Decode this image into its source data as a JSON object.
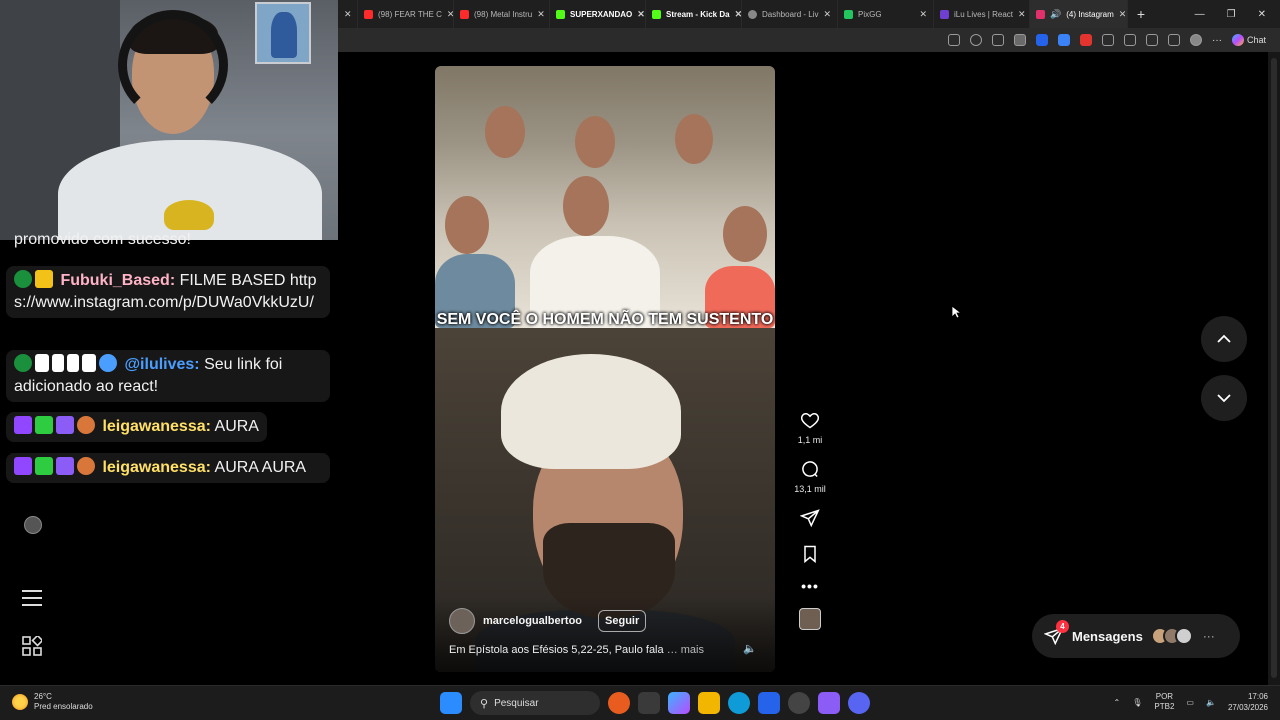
{
  "browser": {
    "tabs": [
      {
        "label": "",
        "icon_color": "#ffffff"
      },
      {
        "label": "(98) FEAR THE C",
        "icon_color": "#ff2a2a"
      },
      {
        "label": "(98) Metal Instru",
        "icon_color": "#ff2a2a"
      },
      {
        "label": "SUPERXANDAO",
        "icon_color": "#53fc18"
      },
      {
        "label": "Stream - Kick Da",
        "icon_color": "#53fc18"
      },
      {
        "label": "Dashboard - Liv",
        "icon_color": "#888888"
      },
      {
        "label": "PixGG",
        "icon_color": "#22c55e"
      },
      {
        "label": "iLu Lives | React",
        "icon_color": "#6f3fd1"
      },
      {
        "label": "(4) Instagram",
        "icon_color": "#e1306c"
      }
    ],
    "new_tab": "+",
    "chat_label": "Chat"
  },
  "chat": {
    "messages": [
      {
        "prefix": "",
        "user": "",
        "text": "promovido com sucesso!"
      },
      {
        "user": "Fubuki_Based:",
        "text": " FILME BASED https://www.instagram.com/p/DUWa0VkkUzU/",
        "user_color": "#ffb3c7"
      },
      {
        "user": "@ilulives:",
        "text": " Seu link foi adicionado ao react!",
        "user_color": "#4a9eff"
      },
      {
        "user": "leigawanessa:",
        "text": " AURA",
        "user_color": "#ffe066"
      },
      {
        "user": "leigawanessa:",
        "text": " AURA AURA",
        "user_color": "#ffe066"
      }
    ]
  },
  "post": {
    "caption": "SEM VOCÊ O HOMEM NÃO TEM SUSTENTO",
    "author": "marcelogualbertoo",
    "follow_label": "Seguir",
    "description": "Em Epístola aos Efésios 5,22-25, Paulo fala",
    "more_label": "… mais",
    "likes": "1,1 mi",
    "comments": "13,1 mil",
    "more_dots": "•••"
  },
  "messages_bar": {
    "label": "Mensagens",
    "badge": "4",
    "more": "···"
  },
  "taskbar": {
    "weather_temp": "26°C",
    "weather_desc": "Pred ensolarado",
    "search_placeholder": "Pesquisar",
    "lang_top": "POR",
    "lang_bottom": "PTB2",
    "time": "17:06",
    "date": "27/03/2026"
  },
  "colors": {
    "instagram_bg": "#000000",
    "accent_red": "#ff3040"
  }
}
